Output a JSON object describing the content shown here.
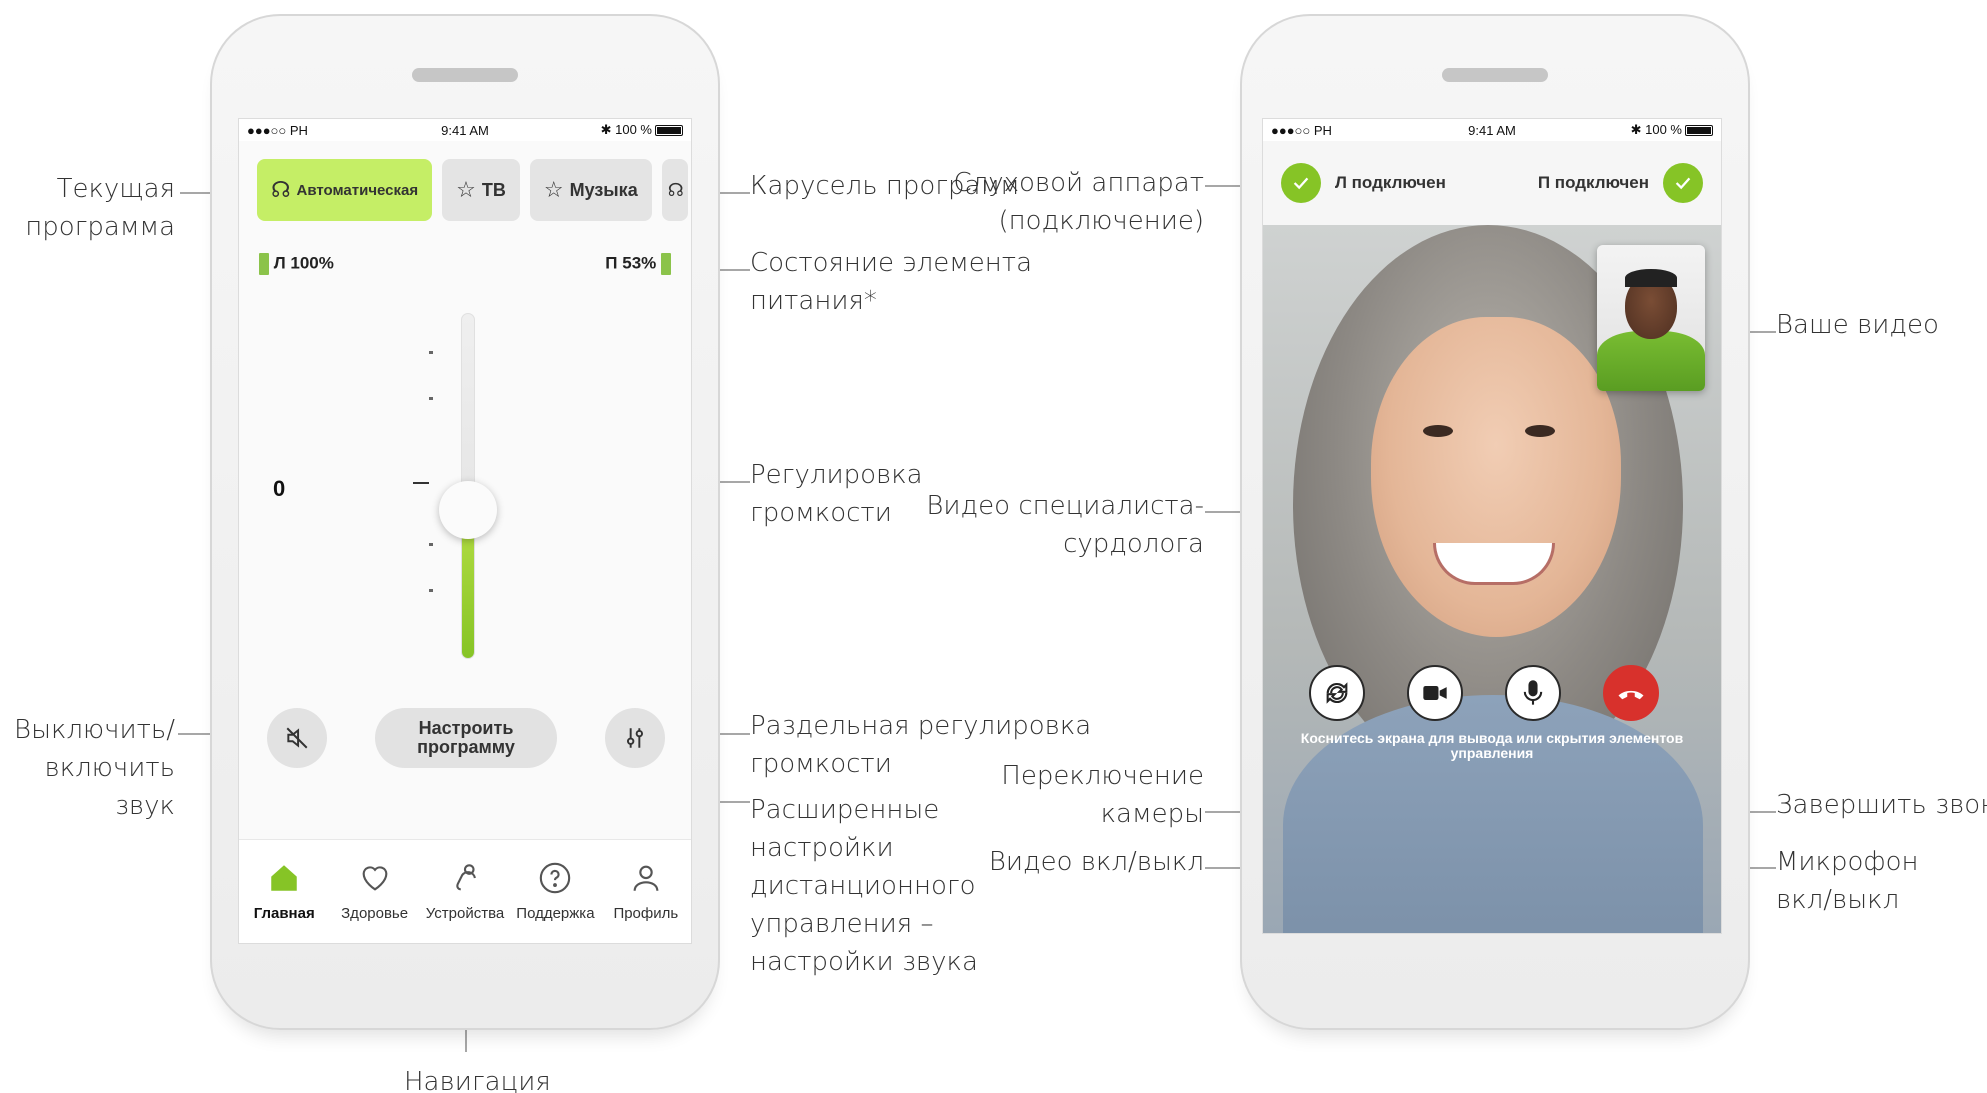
{
  "phone1": {
    "status": {
      "carrier": "●●●○○ PH",
      "time": "9:41 AM",
      "battery": "100 %"
    },
    "programs": [
      {
        "label": "Автоматическая",
        "icon": "ear-icon",
        "active": true
      },
      {
        "label": "ТВ",
        "icon": "star-icon",
        "active": false
      },
      {
        "label": "Музыка",
        "icon": "star-icon",
        "active": false
      }
    ],
    "battery_left": "Л 100%",
    "battery_right": "П 53%",
    "volume": {
      "value": "0",
      "level_fraction": 0.43
    },
    "mute_icon": "speaker-off-icon",
    "adjust_program_label": "Настроить программу",
    "split_volume_icon": "sliders-icon",
    "nav": [
      {
        "label": "Главная",
        "icon": "home-icon",
        "active": true
      },
      {
        "label": "Здоровье",
        "icon": "heart-icon",
        "active": false
      },
      {
        "label": "Устройства",
        "icon": "hearing-aid-icon",
        "active": false
      },
      {
        "label": "Поддержка",
        "icon": "help-icon",
        "active": false
      },
      {
        "label": "Профиль",
        "icon": "person-icon",
        "active": false
      }
    ]
  },
  "phone2": {
    "status": {
      "carrier": "●●●○○ PH",
      "time": "9:41 AM",
      "battery": "100 %"
    },
    "left_connected": "Л подключен",
    "right_connected": "П подключен",
    "hint": "Коснитесь экрана для вывода или скрытия элементов управления",
    "buttons": [
      "switch-camera-icon",
      "video-icon",
      "microphone-icon",
      "end-call-icon"
    ]
  },
  "callouts": {
    "current_program": "Текущая\nпрограмма",
    "program_carousel": "Карусель программ",
    "battery_state": "Состояние элемента\nпитания*",
    "volume_control": "Регулировка\nгромкости",
    "mute": "Выключить/\nвключить звук",
    "split_volume": "Раздельная регулировка\nгромкости",
    "advanced_settings": "Расширенные\nнастройки\nдистанционного\nуправления –\nнастройки звука",
    "navigation": "Навигация",
    "hearing_aid_connection": "Слуховой аппарат\n(подключение)",
    "your_video": "Ваше видео",
    "specialist_video": "Видео специалиста-\nсурдолога",
    "switch_camera": "Переключение\nкамеры",
    "video_toggle": "Видео вкл/выкл",
    "end_call": "Завершить звонок",
    "microphone": "Микрофон\nвкл/выкл"
  }
}
